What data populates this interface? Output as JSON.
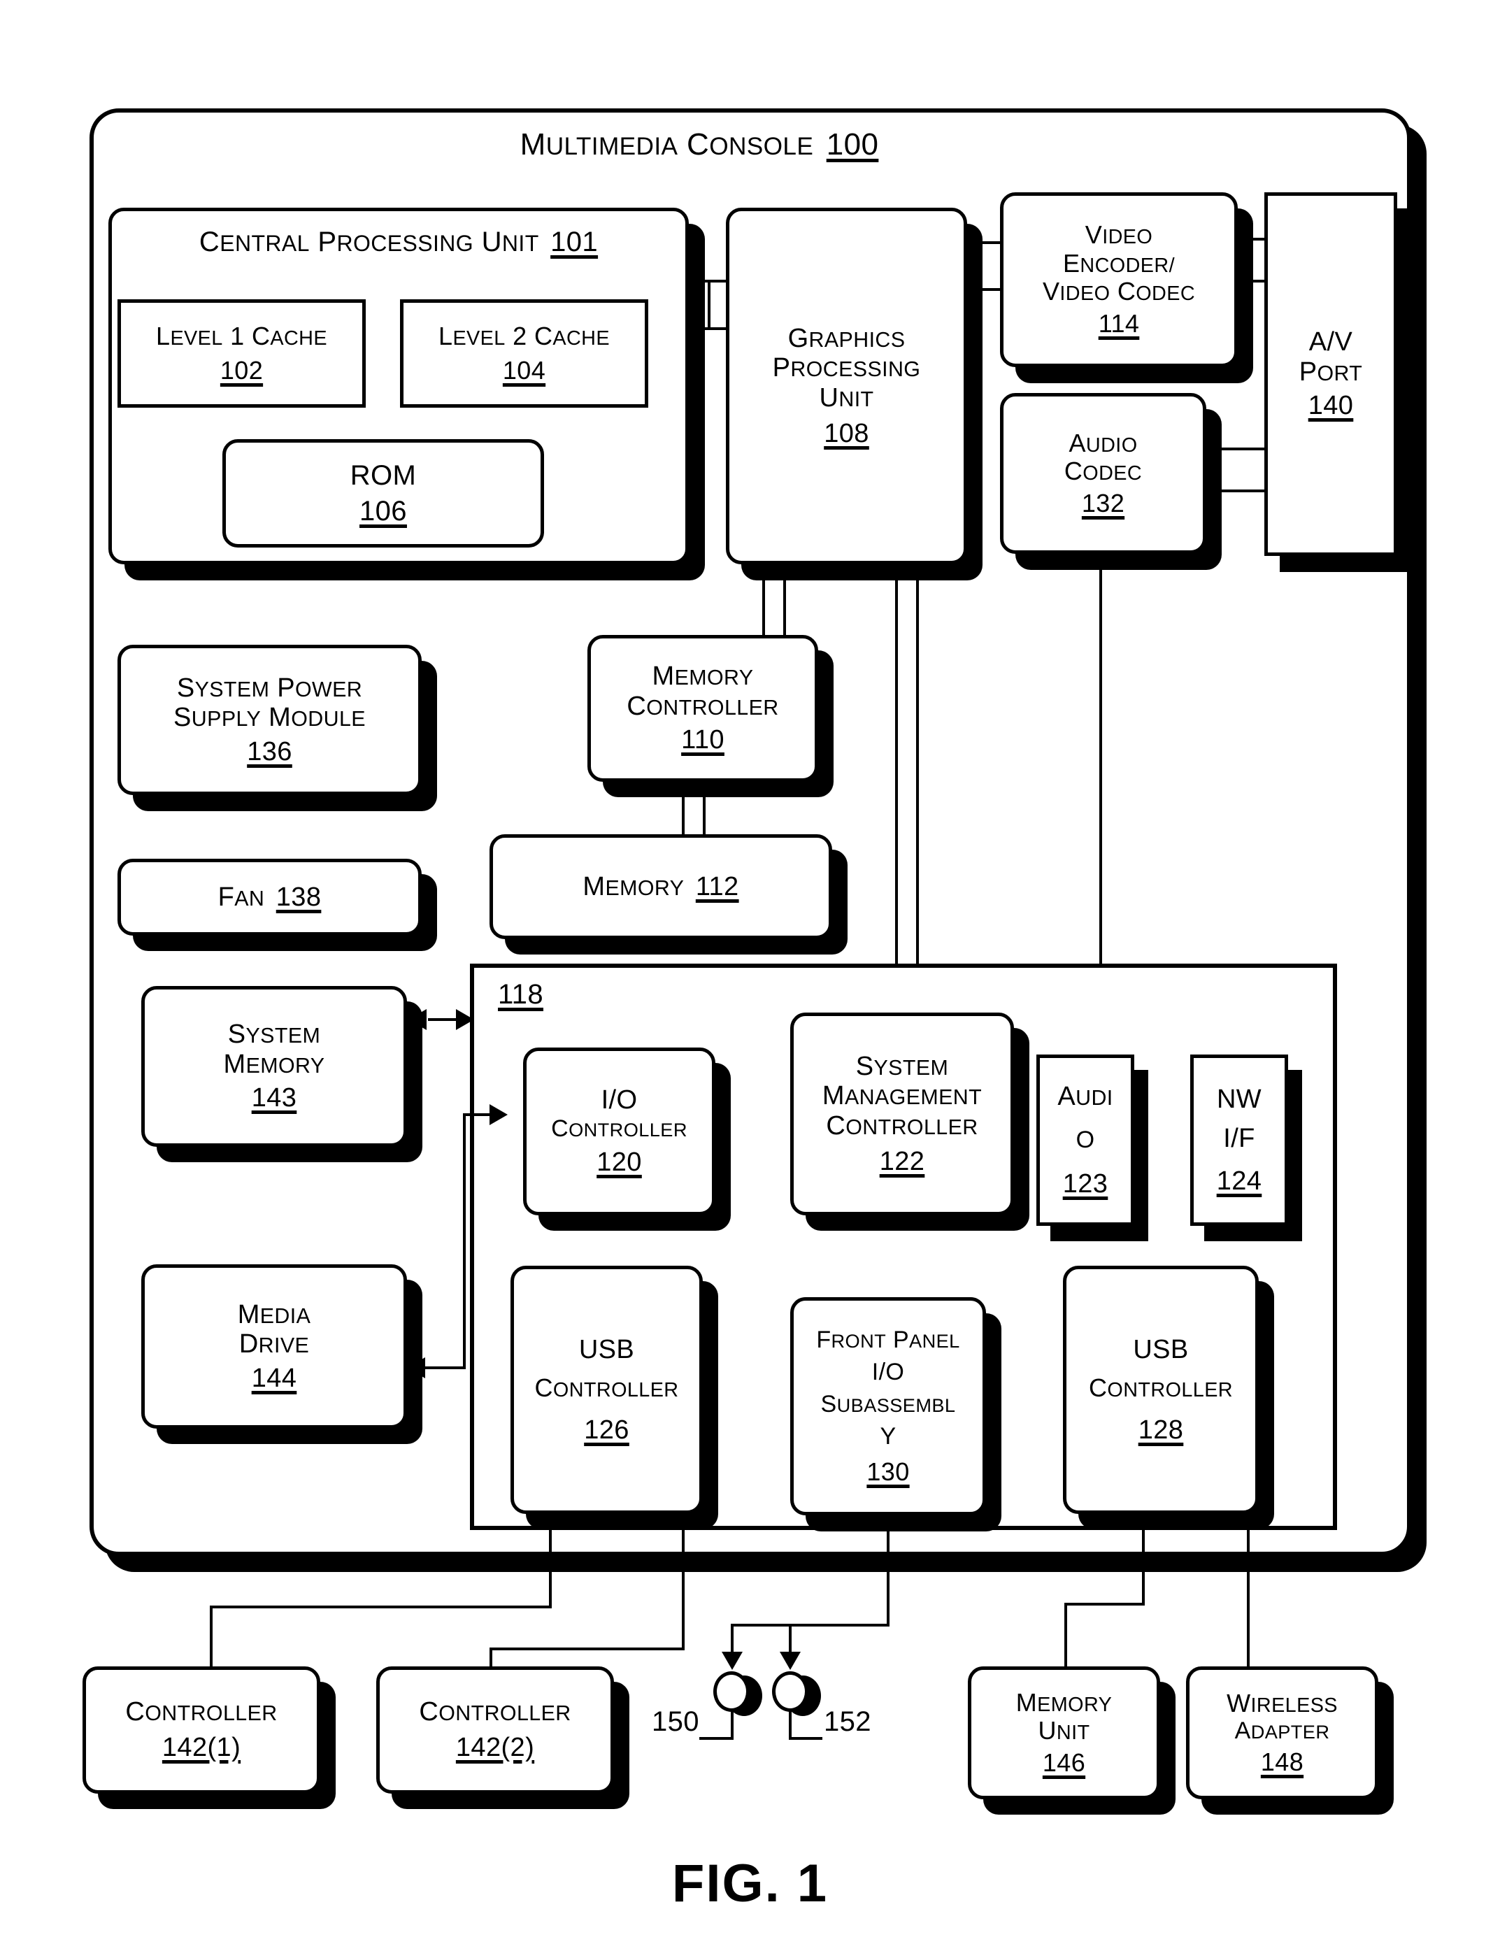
{
  "figure": {
    "caption": "FIG. 1"
  },
  "console": {
    "title_text": "Multimedia Console",
    "title_ref": "100"
  },
  "blocks": {
    "cpu": {
      "lines": [
        "Central Processing Unit"
      ],
      "ref": "101"
    },
    "l1cache": {
      "lines": [
        "Level 1 Cache"
      ],
      "ref": "102"
    },
    "l2cache": {
      "lines": [
        "Level 2 Cache"
      ],
      "ref": "104"
    },
    "rom": {
      "lines": [
        "ROM"
      ],
      "ref": "106"
    },
    "gpu": {
      "lines": [
        "Graphics",
        "Processing",
        "Unit"
      ],
      "ref": "108"
    },
    "video_codec": {
      "lines": [
        "Video",
        "Encoder/",
        "Video Codec"
      ],
      "ref": "114"
    },
    "av_port": {
      "lines": [
        "A/V",
        "Port"
      ],
      "ref": "140"
    },
    "audio_codec": {
      "lines": [
        "Audio",
        "Codec"
      ],
      "ref": "132"
    },
    "psu": {
      "lines": [
        "System Power",
        "Supply Module"
      ],
      "ref": "136"
    },
    "fan": {
      "lines": [
        "Fan"
      ],
      "ref": "138"
    },
    "mem_ctrl": {
      "lines": [
        "Memory",
        "Controller"
      ],
      "ref": "110"
    },
    "memory": {
      "lines": [
        "Memory"
      ],
      "ref": "112"
    },
    "sys_memory": {
      "lines": [
        "System",
        "Memory"
      ],
      "ref": "143"
    },
    "media_drive": {
      "lines": [
        "Media",
        "Drive"
      ],
      "ref": "144"
    },
    "io_ctrl": {
      "lines": [
        "I/O",
        "controller"
      ],
      "ref": "120"
    },
    "smc": {
      "lines": [
        "System",
        "Management",
        "Controller"
      ],
      "ref": "122"
    },
    "audio": {
      "lines": [
        "Audi",
        "o"
      ],
      "ref": "123"
    },
    "nwif": {
      "lines": [
        "NW",
        "I/F"
      ],
      "ref": "124"
    },
    "usb1": {
      "lines": [
        "USB",
        "Controller"
      ],
      "ref": "126"
    },
    "front_panel": {
      "lines": [
        "Front Panel",
        "I/O",
        "Subassembl",
        "y"
      ],
      "ref": "130"
    },
    "usb2": {
      "lines": [
        "USB",
        "Controller"
      ],
      "ref": "128"
    },
    "controller1": {
      "lines": [
        "Controller"
      ],
      "ref": "142(1)"
    },
    "controller2": {
      "lines": [
        "Controller"
      ],
      "ref": "142(2)"
    },
    "memory_unit": {
      "lines": [
        "Memory",
        "Unit"
      ],
      "ref": "146"
    },
    "wireless": {
      "lines": [
        "Wireless",
        "adapter"
      ],
      "ref": "148"
    }
  },
  "bus": {
    "ref": "118"
  },
  "connectors": {
    "left_ref": "150",
    "right_ref": "152"
  },
  "colors": {
    "ink": "#000000",
    "paper": "#ffffff"
  }
}
